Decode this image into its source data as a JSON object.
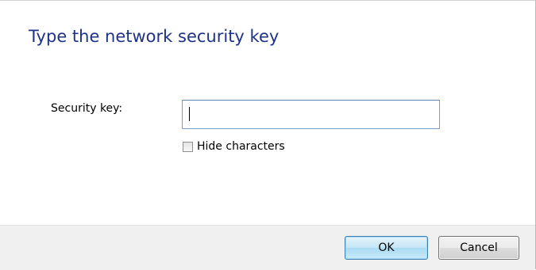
{
  "dialog": {
    "heading": "Type the network security key",
    "security_key_label": "Security key:",
    "security_key_value": "",
    "hide_characters_label": "Hide characters",
    "hide_characters_checked": false
  },
  "buttons": {
    "ok_label": "OK",
    "cancel_label": "Cancel"
  },
  "colors": {
    "heading": "#1e3287",
    "footer_background": "#f0f0f0",
    "input_border": "#7aa0c9",
    "ok_border": "#3c7fb1"
  }
}
